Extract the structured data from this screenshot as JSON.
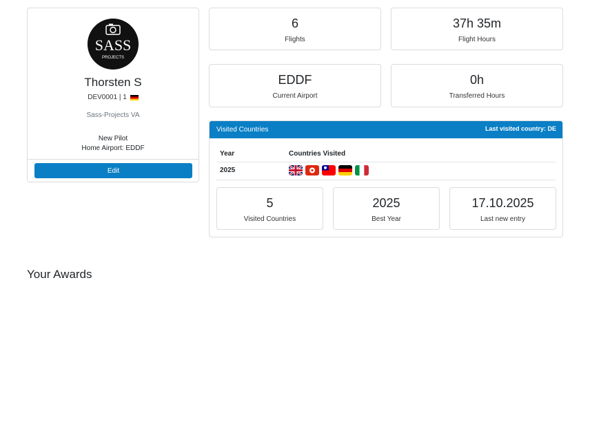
{
  "profile": {
    "logo_text": "SASS",
    "logo_subtext": "PROJECTS",
    "name": "Thorsten S",
    "pilot_id": "DEV0001 | 1",
    "country_flag": "de",
    "airline": "Sass-Projects VA",
    "rank": "New Pilot",
    "home_airport": "Home Airport: EDDF",
    "edit_label": "Edit",
    "colors": {
      "edit_button": "#0a7fc5"
    }
  },
  "stats": {
    "flights": {
      "value": "6",
      "label": "Flights"
    },
    "flight_hours": {
      "value": "37h 35m",
      "label": "Flight Hours"
    },
    "current_airport": {
      "value": "EDDF",
      "label": "Current Airport"
    },
    "transferred_hours": {
      "value": "0h",
      "label": "Transferred Hours"
    }
  },
  "visited_countries": {
    "title": "Visited Countries",
    "last_visited": "Last visited country: DE",
    "header_color": "#0a7fc5",
    "columns": [
      "Year",
      "Countries Visited"
    ],
    "rows": [
      {
        "year": "2025",
        "flags": [
          "gb",
          "hk",
          "tw",
          "de",
          "it"
        ]
      }
    ],
    "summary": {
      "visited": {
        "value": "5",
        "label": "Visited Countries"
      },
      "best_year": {
        "value": "2025",
        "label": "Best Year"
      },
      "last_entry": {
        "value": "17.10.2025",
        "label": "Last new entry"
      }
    }
  },
  "awards": {
    "title": "Your Awards"
  }
}
